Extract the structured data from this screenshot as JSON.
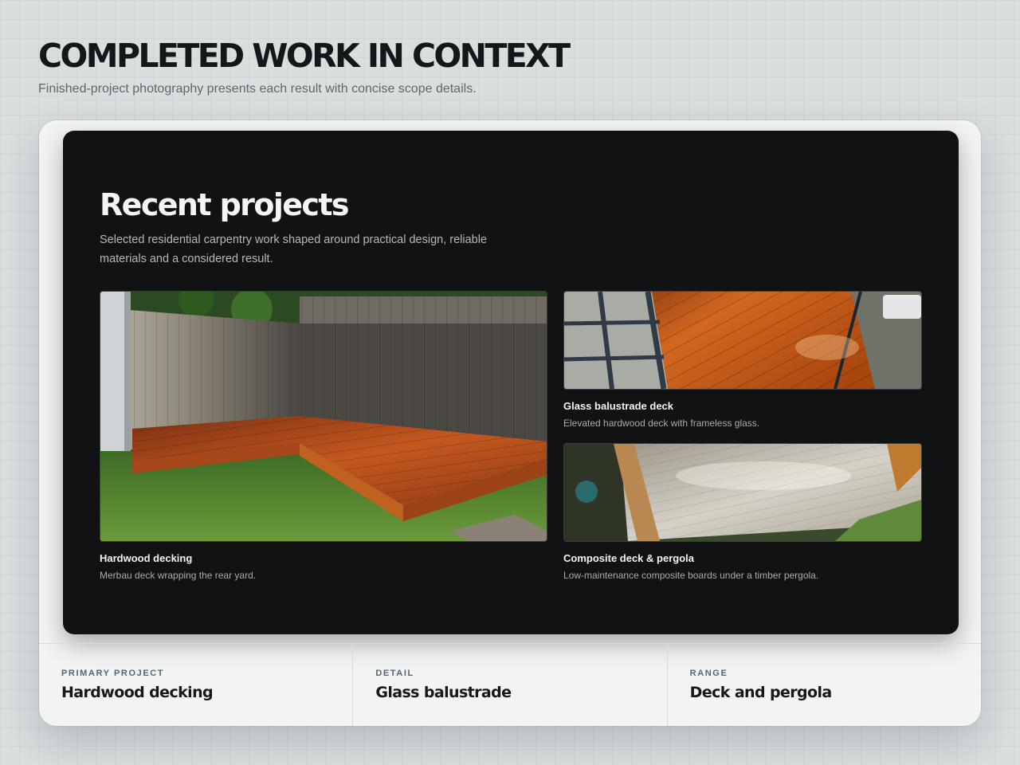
{
  "header": {
    "title": "COMPLETED WORK IN CONTEXT",
    "subtitle": "Finished-project photography presents each result with concise scope details."
  },
  "showcase": {
    "title": "Recent projects",
    "description": "Selected residential carpentry work shaped around practical design, reliable materials and a considered result.",
    "projects": [
      {
        "title": "Hardwood decking",
        "description": "Merbau deck wrapping the rear yard.",
        "image": "hardwood-deck-photo"
      },
      {
        "title": "Glass balustrade deck",
        "description": "Elevated hardwood deck with frameless glass.",
        "image": "glass-balustrade-deck-photo"
      },
      {
        "title": "Composite deck & pergola",
        "description": "Low-maintenance composite boards under a timber pergola.",
        "image": "composite-deck-pergola-photo"
      }
    ]
  },
  "stats": [
    {
      "label": "PRIMARY PROJECT",
      "value": "Hardwood decking"
    },
    {
      "label": "DETAIL",
      "value": "Glass balustrade"
    },
    {
      "label": "RANGE",
      "value": "Deck and pergola"
    }
  ],
  "colors": {
    "background": "#d9dedf",
    "card": "#f2f4f3",
    "panel": "#111214",
    "accent_label": "#4f6677",
    "timber": "#b4501c"
  }
}
